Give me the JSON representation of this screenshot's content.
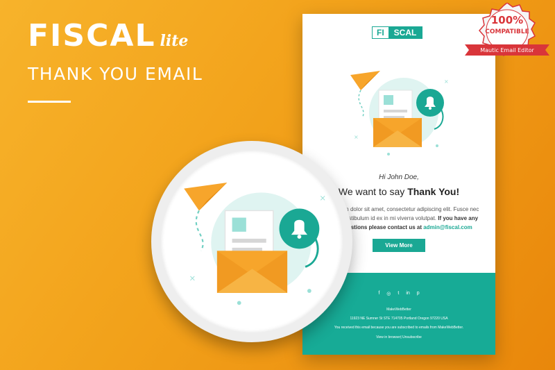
{
  "hero": {
    "brand": "FISCAL",
    "lite": "lite",
    "subtitle": "THANK YOU EMAIL"
  },
  "badge": {
    "line1": "100%",
    "line2": "COMPATIBLE",
    "line3": "Mautic Email Editor"
  },
  "email": {
    "logo_left": "FI",
    "logo_right": "SCAL",
    "greeting": "Hi John Doe,",
    "headline_prefix": "We want to say ",
    "headline_bold": "Thank You!",
    "body_line1": "um dolor sit amet, consectetur adipiscing elit. Fusce nec",
    "body_line2": "Vestibulum id ex in mi viverra volutpat.",
    "body_bold1": " If you have any",
    "body_bold2": "estions please contact us at ",
    "body_email": "admin@fiscal.com",
    "cta_label": "View More",
    "social_icons": [
      "f",
      "◎",
      "t",
      "in",
      "p"
    ],
    "footer_company": "MakeWebBetter",
    "footer_address": "11923 NE Sumner St STE 714705 Portland Oregon 97220 USA",
    "footer_note": "You received this email because you are subscribed to emails from MakeWebBetter.",
    "footer_links": "View in browser| Unsubscribe"
  },
  "colors": {
    "background": "#f2a11a",
    "teal": "#1aa894",
    "orange": "#f4a12b",
    "badge_red": "#d9353a"
  }
}
